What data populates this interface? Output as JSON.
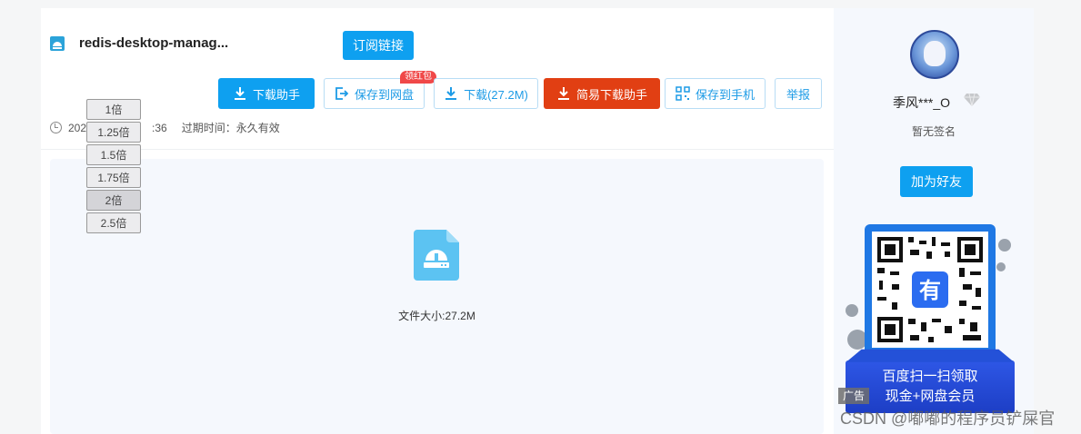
{
  "file": {
    "title": "redis-desktop-manag...",
    "subscribe_label": "订阅链接",
    "date_partial": "202",
    "time_partial": ":36",
    "expire_label": "过期时间：永久有效",
    "size_label": "文件大小:27.2M"
  },
  "actions": {
    "download_helper": "下载助手",
    "save_to_pan": "保存到网盘",
    "red_packet_badge": "领红包",
    "download": "下载(27.2M)",
    "easy_download_helper": "简易下载助手",
    "save_to_phone": "保存到手机",
    "report": "举报"
  },
  "speed_options": [
    "1倍",
    "1.25倍",
    "1.5倍",
    "1.75倍",
    "2倍",
    "2.5倍"
  ],
  "speed_selected": "2倍",
  "user": {
    "name": "季风***_O",
    "signature": "暂无签名",
    "add_friend": "加为好友"
  },
  "ad": {
    "line1": "百度扫一扫领取",
    "line2": "现金+网盘会员",
    "tag": "广告",
    "qr_center_glyph": "有"
  },
  "watermark": "CSDN @嘟嘟的程序员铲屎官",
  "colors": {
    "primary": "#0ea0f0",
    "danger": "#e13f13",
    "badge": "#f04848",
    "file_icon": "#5cc3f2"
  }
}
